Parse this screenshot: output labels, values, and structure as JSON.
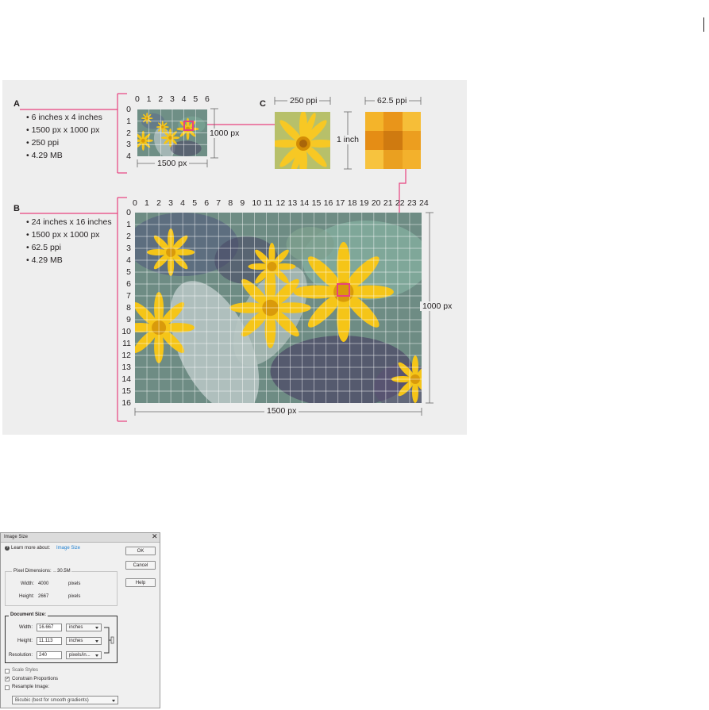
{
  "figure": {
    "section_a": {
      "letter": "A",
      "bullets": [
        "• 6 inches x 4 inches",
        "• 1500 px x 1000 px",
        "• 250 ppi",
        "• 4.29 MB"
      ],
      "x_ticks": [
        "0",
        "1",
        "2",
        "3",
        "4",
        "5",
        "6"
      ],
      "y_ticks": [
        "0",
        "1",
        "2",
        "3",
        "4"
      ],
      "width_label": "1500 px",
      "height_label": "1000 px"
    },
    "section_b": {
      "letter": "B",
      "bullets": [
        "• 24 inches x 16 inches",
        "• 1500 px x 1000 px",
        "• 62.5 ppi",
        "• 4.29 MB"
      ],
      "x_ticks": [
        "0",
        "1",
        "2",
        "3",
        "4",
        "5",
        "6",
        "7",
        "8",
        "9",
        "10",
        "11",
        "12",
        "13",
        "14",
        "15",
        "16",
        "17",
        "18",
        "19",
        "20",
        "21",
        "22",
        "23",
        "24"
      ],
      "y_ticks": [
        "0",
        "1",
        "2",
        "3",
        "4",
        "5",
        "6",
        "7",
        "8",
        "9",
        "10",
        "11",
        "12",
        "13",
        "14",
        "15",
        "16"
      ],
      "width_label": "1500 px",
      "height_label": "1000 px"
    },
    "section_c": {
      "letter": "C",
      "left_label": "250 ppi",
      "right_label": "62.5 ppi",
      "inch_label": "1 inch"
    },
    "colors": {
      "callout": "#e8417f",
      "flower": "#f5c518",
      "foliage": "#6f8f86"
    }
  },
  "dialog": {
    "title": "Image Size",
    "learn_prefix": "Learn more about:",
    "learn_link": "Image Size",
    "buttons": {
      "ok": "OK",
      "cancel": "Cancel",
      "help": "Help"
    },
    "pixel_dimensions": {
      "label": "Pixel Dimensions:",
      "size": "30.5M",
      "width_label": "Width:",
      "width_value": "4000",
      "width_unit": "pixels",
      "height_label": "Height:",
      "height_value": "2667",
      "height_unit": "pixels"
    },
    "document_size": {
      "label": "Document Size:",
      "width_label": "Width:",
      "width_value": "16.667",
      "width_unit": "inches",
      "height_label": "Height:",
      "height_value": "11.113",
      "height_unit": "inches",
      "resolution_label": "Resolution:",
      "resolution_value": "240",
      "resolution_unit": "pixels/in..."
    },
    "options": {
      "scale_styles": "Scale Styles",
      "scale_styles_checked": false,
      "constrain": "Constrain Proportions",
      "constrain_checked": true,
      "resample": "Resample Image:",
      "resample_checked": false,
      "method": "Bicubic (best for smooth gradients)"
    }
  }
}
